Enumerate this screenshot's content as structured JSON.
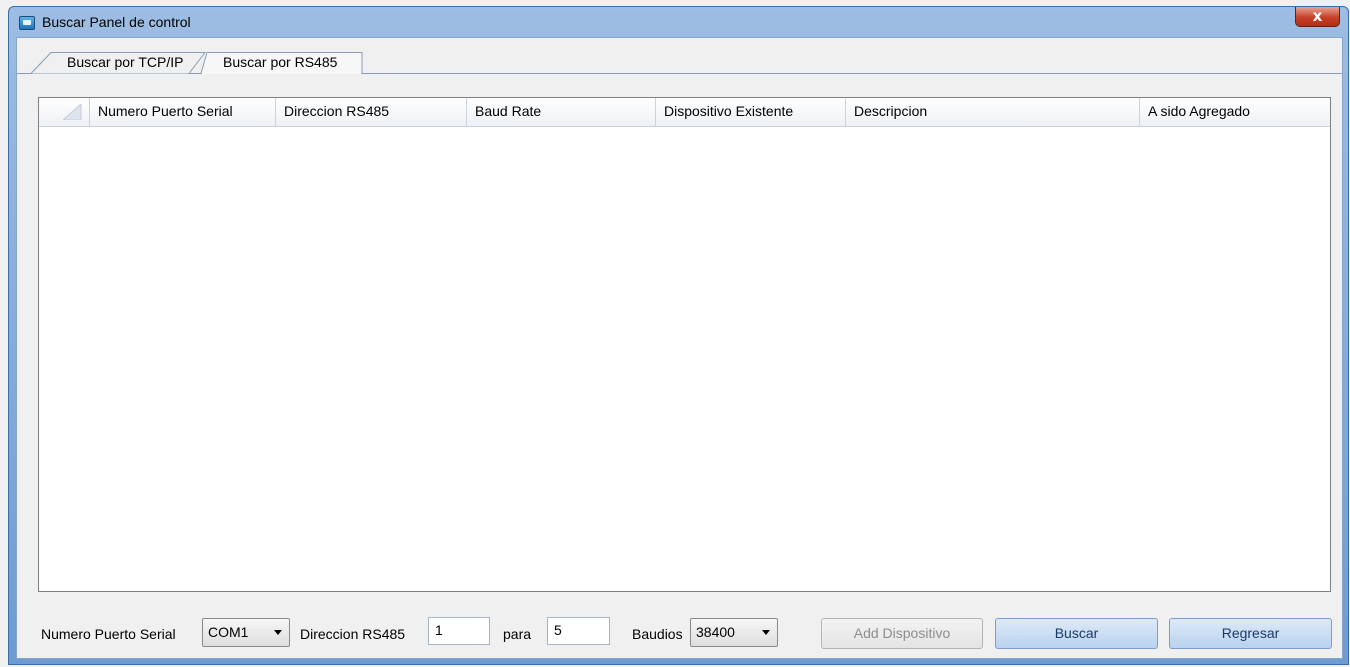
{
  "window": {
    "title": "Buscar Panel de control",
    "close_label": "x"
  },
  "tabs": [
    {
      "label": "Buscar por TCP/IP",
      "active": false
    },
    {
      "label": "Buscar por RS485",
      "active": true
    }
  ],
  "table": {
    "columns": [
      "Numero Puerto Serial",
      "Direccion RS485",
      "Baud Rate",
      "Dispositivo Existente",
      "Descripcion",
      "A sido Agregado"
    ],
    "rows": []
  },
  "form": {
    "serial_port_label": "Numero Puerto Serial",
    "serial_port_value": "COM1",
    "rs485_label": "Direccion RS485",
    "rs485_from": "1",
    "para_label": "para",
    "rs485_to": "5",
    "baud_label": "Baudios",
    "baud_value": "38400"
  },
  "buttons": {
    "add_device": "Add Dispositivo",
    "search": "Buscar",
    "back": "Regresar"
  },
  "colors": {
    "title_bar": "#7ea6d8",
    "close_button": "#c6412a",
    "button_blue": "#c6dbf3"
  }
}
